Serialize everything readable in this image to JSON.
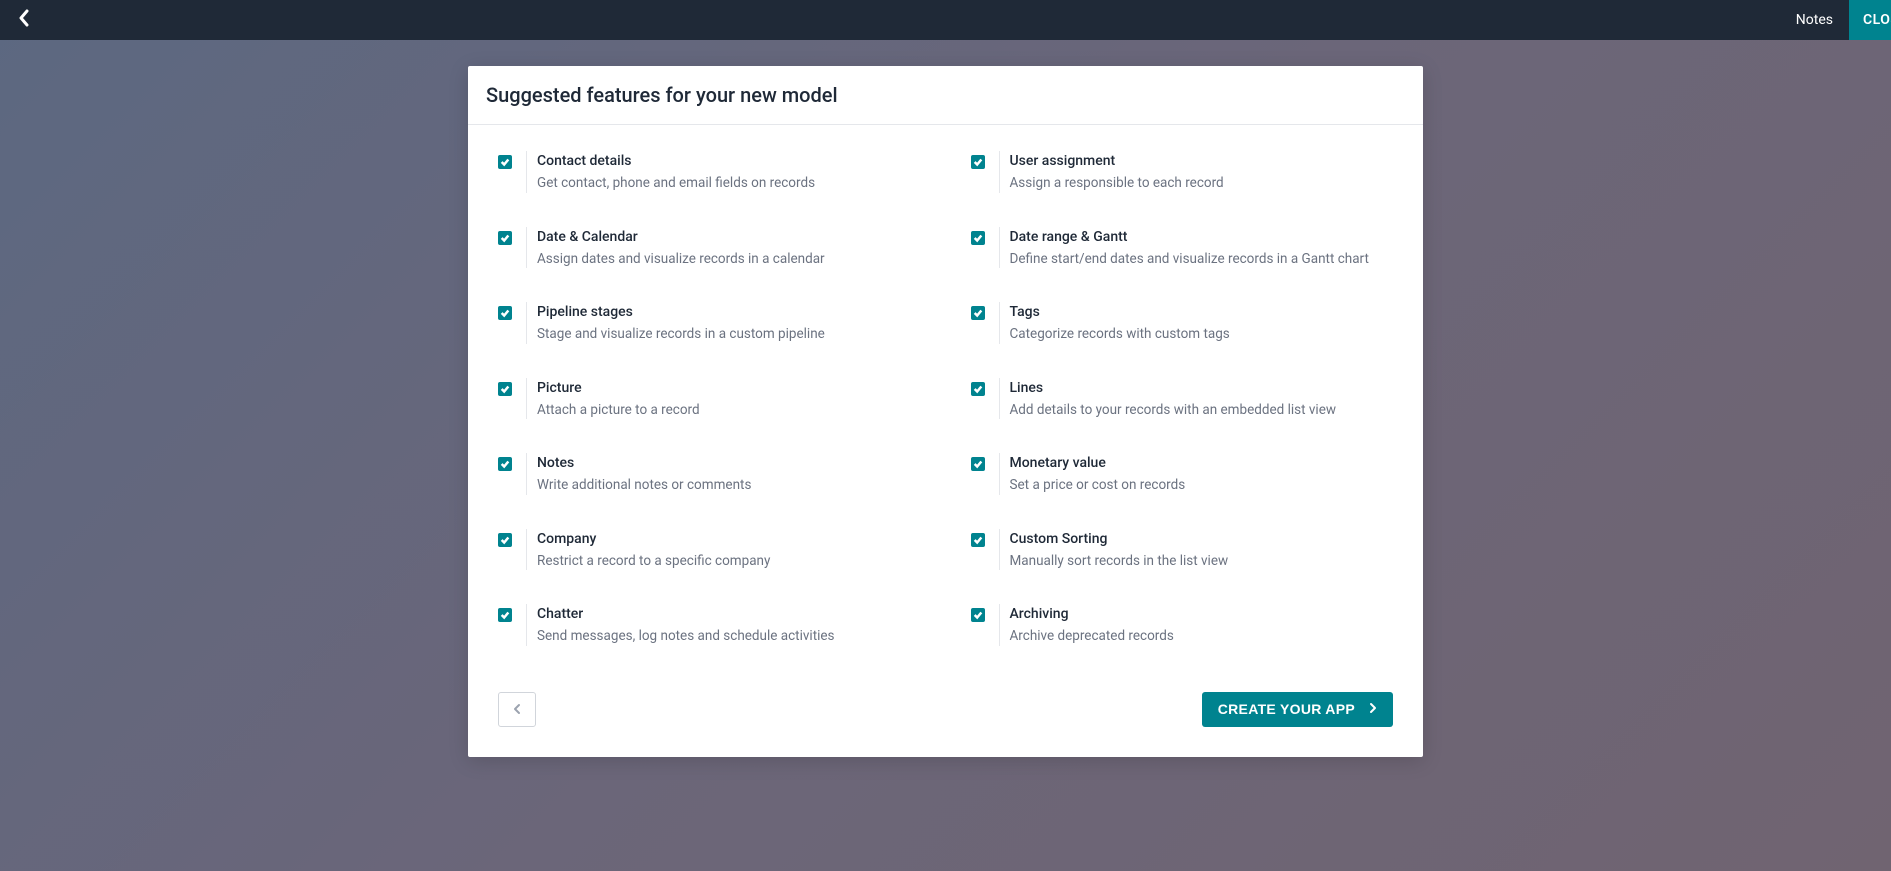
{
  "topbar": {
    "notes_label": "Notes",
    "close_label": "CLOSE"
  },
  "modal": {
    "title": "Suggested features for your new model",
    "features_left": [
      {
        "title": "Contact details",
        "desc": "Get contact, phone and email fields on records"
      },
      {
        "title": "Date & Calendar",
        "desc": "Assign dates and visualize records in a calendar"
      },
      {
        "title": "Pipeline stages",
        "desc": "Stage and visualize records in a custom pipeline"
      },
      {
        "title": "Picture",
        "desc": "Attach a picture to a record"
      },
      {
        "title": "Notes",
        "desc": "Write additional notes or comments"
      },
      {
        "title": "Company",
        "desc": "Restrict a record to a specific company"
      },
      {
        "title": "Chatter",
        "desc": "Send messages, log notes and schedule activities"
      }
    ],
    "features_right": [
      {
        "title": "User assignment",
        "desc": "Assign a responsible to each record"
      },
      {
        "title": "Date range & Gantt",
        "desc": "Define start/end dates and visualize records in a Gantt chart"
      },
      {
        "title": "Tags",
        "desc": "Categorize records with custom tags"
      },
      {
        "title": "Lines",
        "desc": "Add details to your records with an embedded list view"
      },
      {
        "title": "Monetary value",
        "desc": "Set a price or cost on records"
      },
      {
        "title": "Custom Sorting",
        "desc": "Manually sort records in the list view"
      },
      {
        "title": "Archiving",
        "desc": "Archive deprecated records"
      }
    ],
    "create_button": "CREATE YOUR APP"
  }
}
